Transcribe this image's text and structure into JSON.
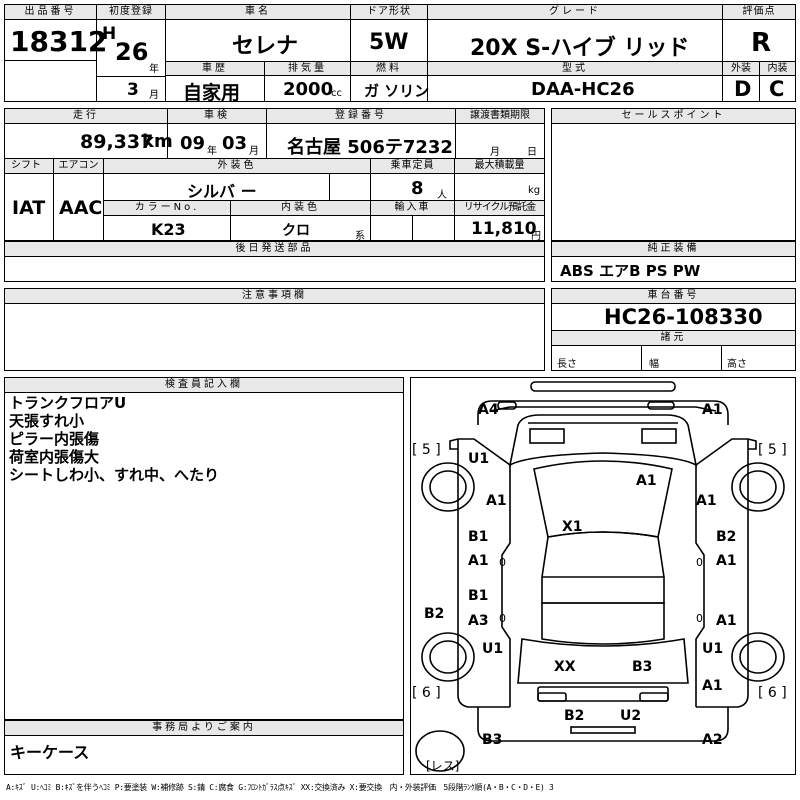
{
  "header": {
    "lot_no_label": "出品番号",
    "lot_no": "18312",
    "reg_label": "初度登録",
    "era": "H",
    "year": "26",
    "year_unit": "年",
    "month": "3",
    "month_unit": "月",
    "name_label": "車名",
    "name": "セレナ",
    "door_label": "ドア形状",
    "door": "5W",
    "grade_label": "グレード",
    "grade": "20X S-ハイブ リッド",
    "score_label": "評価点",
    "score": "R",
    "history_label": "車歴",
    "history": "自家用",
    "displacement_label": "排気量",
    "displacement": "2000",
    "displacement_unit": "cc",
    "fuel_label": "燃料",
    "fuel": "ガ ソリン",
    "model_label": "型式",
    "model": "DAA-HC26",
    "ext_label": "外装",
    "ext_score": "D",
    "int_label": "内装",
    "int_score": "C"
  },
  "row2": {
    "mileage_label": "走行",
    "mileage": "89,337",
    "mileage_unit": "km",
    "inspection_label": "車検",
    "insp_year": "09",
    "insp_year_unit": "年",
    "insp_month": "03",
    "insp_month_unit": "月",
    "reg_no_label": "登録番号",
    "reg_no": "名古屋 506テ7232",
    "transfer_label": "譲渡書類期限",
    "transfer_month": "月",
    "transfer_day": "日",
    "sales_label": "セールスポイント"
  },
  "row3": {
    "shift_label": "シフト",
    "shift": "IAT",
    "ac_label": "エアコン",
    "ac": "AAC",
    "ext_color_label": "外装色",
    "ext_color": "シルバ ー",
    "capacity_label": "乗車定員",
    "capacity": "8",
    "capacity_unit": "人",
    "load_label": "最大積載量",
    "load_unit": "kg",
    "color_no_label": "カラーNo.",
    "color_no": "K23",
    "int_color_label": "内装色",
    "int_color": "クロ",
    "int_color_unit": "系",
    "import_label": "輸入車",
    "recycle_label": "リサイクル預託金",
    "recycle": "11,810",
    "recycle_unit": "円"
  },
  "parts": {
    "label": "後日発送部品",
    "value": ""
  },
  "equipment": {
    "label": "純正装備",
    "value": "ABS エアB PS PW"
  },
  "notes": {
    "label": "注意事項欄",
    "value": ""
  },
  "chassis": {
    "label": "車台番号",
    "value": "HC26-108330"
  },
  "dims": {
    "label": "諸元",
    "length": "長さ",
    "width": "幅",
    "height": "高さ"
  },
  "inspector": {
    "label": "検査員記入欄",
    "lines": [
      "トランクフロアU",
      "天張すれ小",
      "ピラー内張傷",
      "荷室内張傷大",
      "シートしわ小、すれ中、へたり"
    ]
  },
  "office": {
    "label": "事務局よりご案内",
    "value": "キーケース"
  },
  "diagram": {
    "marks": [
      "A4",
      "A1",
      "U1",
      "A1",
      "A1",
      "A1",
      "X1",
      "B1",
      "B2",
      "A1",
      "A1",
      "B1",
      "B2",
      "A3",
      "A1",
      "U1",
      "U1",
      "XX",
      "B3",
      "A1",
      "B2",
      "U2",
      "B3",
      "A2"
    ],
    "bracket_tl": "[ 5 ]",
    "bracket_tr": "[ 5 ]",
    "bracket_bl": "[ 6 ]",
    "bracket_br": "[ 6 ]",
    "less": "[レス]",
    "seat_marks": [
      "0",
      "0",
      "0",
      "0"
    ]
  },
  "footer": "A:ｷｽﾞ U:ﾍｺﾐ B:ｷｽﾞを伴うﾍｺﾐ P:要塗装 W:補修跡 S:錆 C:腐食 G:ﾌﾛﾝﾄｶﾞﾗｽ点ｷｽﾞ XX:交換済み X:要交換　内・外装評価　5段階ﾗﾝｸ順(A・B・C・D・E) 3"
}
